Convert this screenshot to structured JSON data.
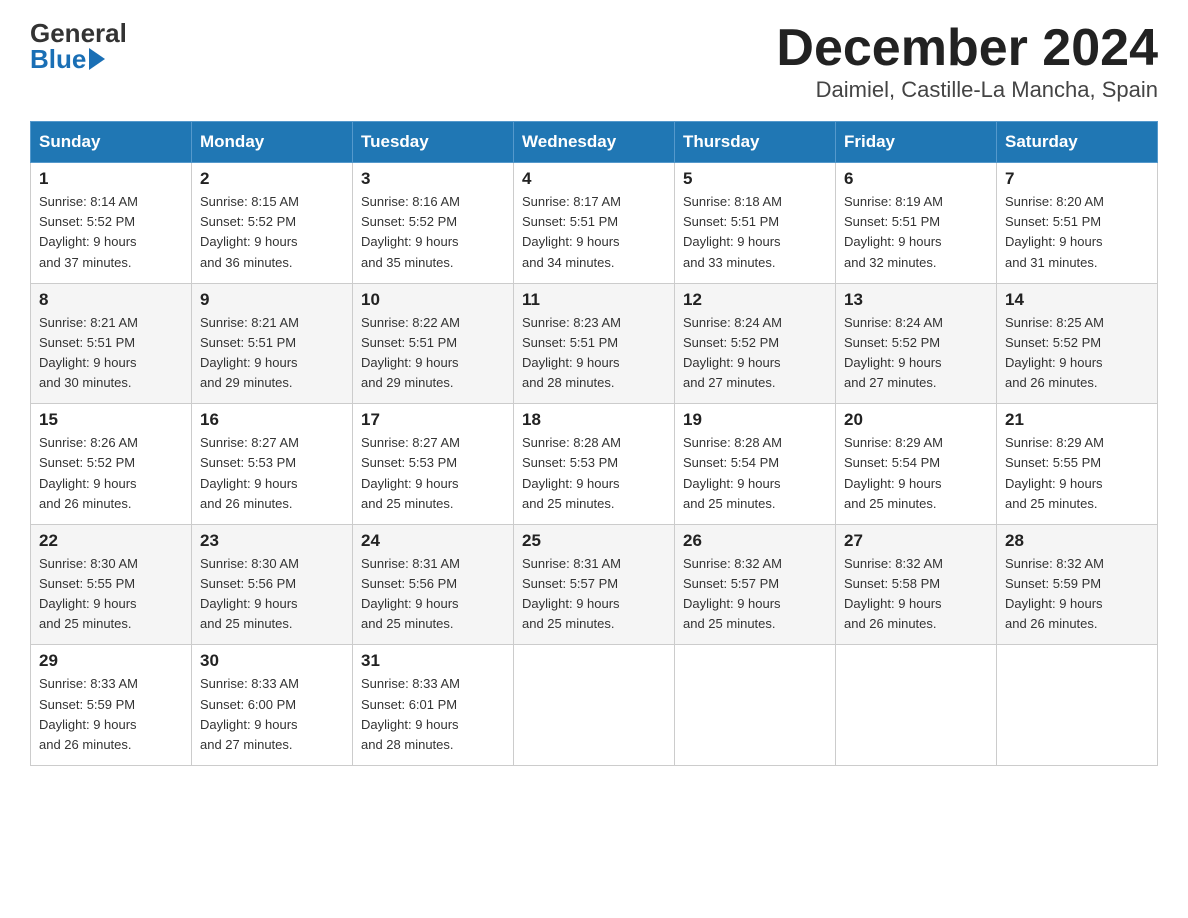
{
  "header": {
    "logo_general": "General",
    "logo_blue": "Blue",
    "month": "December 2024",
    "location": "Daimiel, Castille-La Mancha, Spain"
  },
  "weekdays": [
    "Sunday",
    "Monday",
    "Tuesday",
    "Wednesday",
    "Thursday",
    "Friday",
    "Saturday"
  ],
  "weeks": [
    [
      {
        "day": "1",
        "sunrise": "8:14 AM",
        "sunset": "5:52 PM",
        "daylight": "9 hours and 37 minutes."
      },
      {
        "day": "2",
        "sunrise": "8:15 AM",
        "sunset": "5:52 PM",
        "daylight": "9 hours and 36 minutes."
      },
      {
        "day": "3",
        "sunrise": "8:16 AM",
        "sunset": "5:52 PM",
        "daylight": "9 hours and 35 minutes."
      },
      {
        "day": "4",
        "sunrise": "8:17 AM",
        "sunset": "5:51 PM",
        "daylight": "9 hours and 34 minutes."
      },
      {
        "day": "5",
        "sunrise": "8:18 AM",
        "sunset": "5:51 PM",
        "daylight": "9 hours and 33 minutes."
      },
      {
        "day": "6",
        "sunrise": "8:19 AM",
        "sunset": "5:51 PM",
        "daylight": "9 hours and 32 minutes."
      },
      {
        "day": "7",
        "sunrise": "8:20 AM",
        "sunset": "5:51 PM",
        "daylight": "9 hours and 31 minutes."
      }
    ],
    [
      {
        "day": "8",
        "sunrise": "8:21 AM",
        "sunset": "5:51 PM",
        "daylight": "9 hours and 30 minutes."
      },
      {
        "day": "9",
        "sunrise": "8:21 AM",
        "sunset": "5:51 PM",
        "daylight": "9 hours and 29 minutes."
      },
      {
        "day": "10",
        "sunrise": "8:22 AM",
        "sunset": "5:51 PM",
        "daylight": "9 hours and 29 minutes."
      },
      {
        "day": "11",
        "sunrise": "8:23 AM",
        "sunset": "5:51 PM",
        "daylight": "9 hours and 28 minutes."
      },
      {
        "day": "12",
        "sunrise": "8:24 AM",
        "sunset": "5:52 PM",
        "daylight": "9 hours and 27 minutes."
      },
      {
        "day": "13",
        "sunrise": "8:24 AM",
        "sunset": "5:52 PM",
        "daylight": "9 hours and 27 minutes."
      },
      {
        "day": "14",
        "sunrise": "8:25 AM",
        "sunset": "5:52 PM",
        "daylight": "9 hours and 26 minutes."
      }
    ],
    [
      {
        "day": "15",
        "sunrise": "8:26 AM",
        "sunset": "5:52 PM",
        "daylight": "9 hours and 26 minutes."
      },
      {
        "day": "16",
        "sunrise": "8:27 AM",
        "sunset": "5:53 PM",
        "daylight": "9 hours and 26 minutes."
      },
      {
        "day": "17",
        "sunrise": "8:27 AM",
        "sunset": "5:53 PM",
        "daylight": "9 hours and 25 minutes."
      },
      {
        "day": "18",
        "sunrise": "8:28 AM",
        "sunset": "5:53 PM",
        "daylight": "9 hours and 25 minutes."
      },
      {
        "day": "19",
        "sunrise": "8:28 AM",
        "sunset": "5:54 PM",
        "daylight": "9 hours and 25 minutes."
      },
      {
        "day": "20",
        "sunrise": "8:29 AM",
        "sunset": "5:54 PM",
        "daylight": "9 hours and 25 minutes."
      },
      {
        "day": "21",
        "sunrise": "8:29 AM",
        "sunset": "5:55 PM",
        "daylight": "9 hours and 25 minutes."
      }
    ],
    [
      {
        "day": "22",
        "sunrise": "8:30 AM",
        "sunset": "5:55 PM",
        "daylight": "9 hours and 25 minutes."
      },
      {
        "day": "23",
        "sunrise": "8:30 AM",
        "sunset": "5:56 PM",
        "daylight": "9 hours and 25 minutes."
      },
      {
        "day": "24",
        "sunrise": "8:31 AM",
        "sunset": "5:56 PM",
        "daylight": "9 hours and 25 minutes."
      },
      {
        "day": "25",
        "sunrise": "8:31 AM",
        "sunset": "5:57 PM",
        "daylight": "9 hours and 25 minutes."
      },
      {
        "day": "26",
        "sunrise": "8:32 AM",
        "sunset": "5:57 PM",
        "daylight": "9 hours and 25 minutes."
      },
      {
        "day": "27",
        "sunrise": "8:32 AM",
        "sunset": "5:58 PM",
        "daylight": "9 hours and 26 minutes."
      },
      {
        "day": "28",
        "sunrise": "8:32 AM",
        "sunset": "5:59 PM",
        "daylight": "9 hours and 26 minutes."
      }
    ],
    [
      {
        "day": "29",
        "sunrise": "8:33 AM",
        "sunset": "5:59 PM",
        "daylight": "9 hours and 26 minutes."
      },
      {
        "day": "30",
        "sunrise": "8:33 AM",
        "sunset": "6:00 PM",
        "daylight": "9 hours and 27 minutes."
      },
      {
        "day": "31",
        "sunrise": "8:33 AM",
        "sunset": "6:01 PM",
        "daylight": "9 hours and 28 minutes."
      },
      null,
      null,
      null,
      null
    ]
  ],
  "labels": {
    "sunrise": "Sunrise:",
    "sunset": "Sunset:",
    "daylight": "Daylight:"
  }
}
